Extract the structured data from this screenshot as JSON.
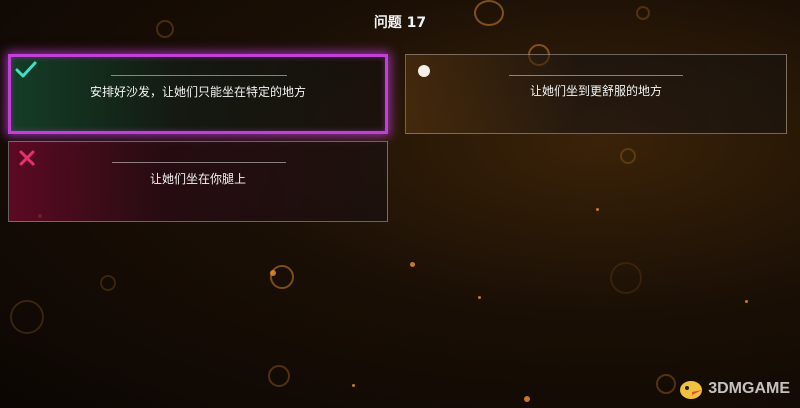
{
  "header": {
    "title": "问题 17"
  },
  "answers": [
    {
      "label": "安排好沙发，让她们只能坐在特定的地方",
      "state": "correct",
      "icon": "check-icon"
    },
    {
      "label": "让她们坐到更舒服的地方",
      "state": "neutral",
      "icon": "dot-icon"
    },
    {
      "label": "让她们坐在你腿上",
      "state": "wrong",
      "icon": "cross-icon"
    }
  ],
  "colors": {
    "correct_accent": "#3ee0c8",
    "selected_border": "#c040d8",
    "wrong_accent": "#e8306a"
  },
  "watermark": {
    "text": "3DMGAME"
  }
}
